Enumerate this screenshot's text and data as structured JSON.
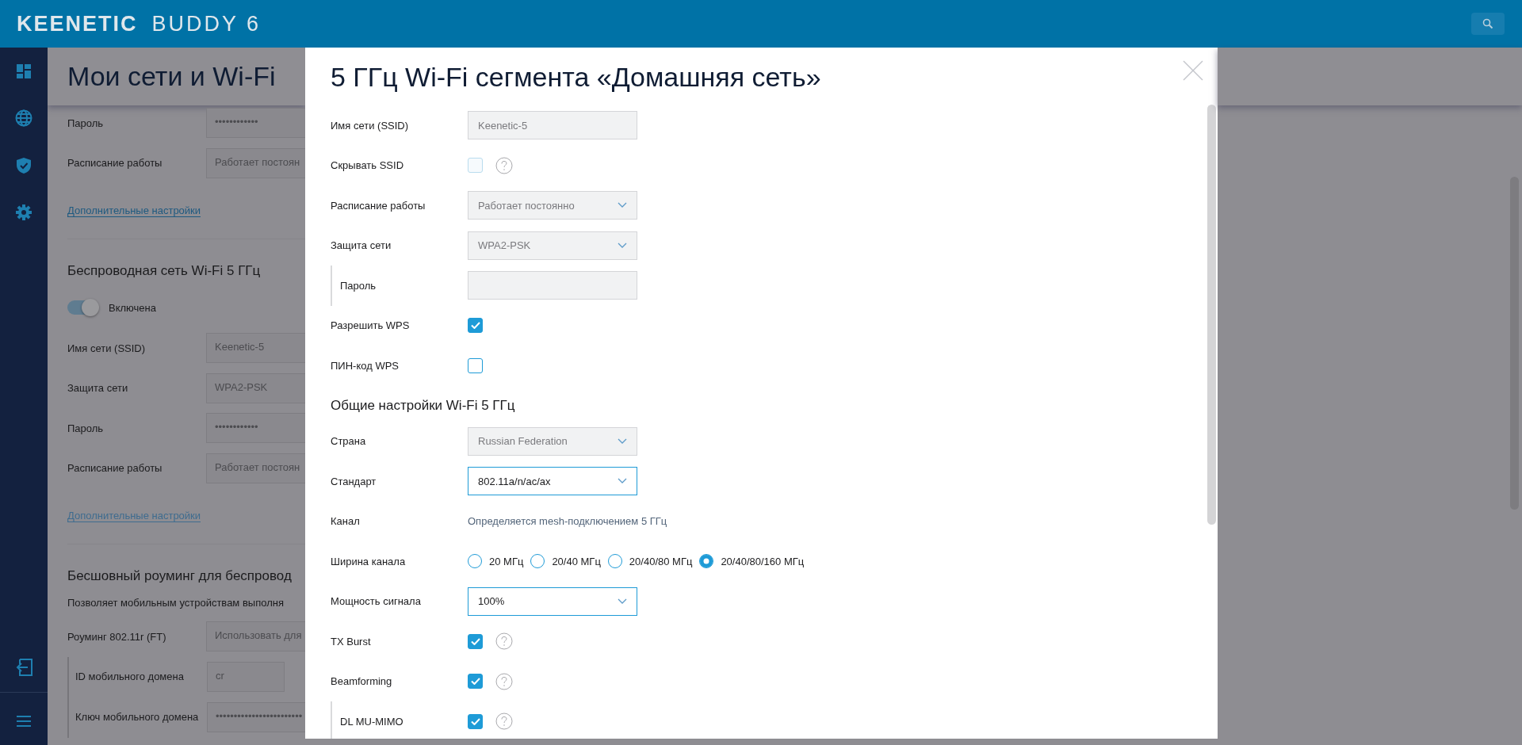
{
  "header": {
    "brand": "KEENETIC",
    "model": "BUDDY 6"
  },
  "background_page": {
    "title": "Мои сети и Wi-Fi",
    "items": [
      {
        "kind": "field",
        "label": "Пароль",
        "value": "••••••••••••"
      },
      {
        "kind": "field",
        "label": "Расписание работы",
        "value": "Работает постоян"
      },
      {
        "kind": "link",
        "label": "Дополнительные настройки",
        "disabled": false
      },
      {
        "kind": "heading",
        "label": "Беспроводная сеть Wi-Fi 5 ГГц"
      },
      {
        "kind": "toggle",
        "label": "Включена",
        "on": true
      },
      {
        "kind": "field",
        "label": "Имя сети (SSID)",
        "value": "Keenetic-5"
      },
      {
        "kind": "field",
        "label": "Защита сети",
        "value": "WPA2-PSK"
      },
      {
        "kind": "field",
        "label": "Пароль",
        "value": "••••••••••••"
      },
      {
        "kind": "field",
        "label": "Расписание работы",
        "value": "Работает постоян"
      },
      {
        "kind": "link",
        "label": "Дополнительные настройки",
        "disabled": true
      },
      {
        "kind": "heading",
        "label": "Бесшовный роуминг для беспровод"
      },
      {
        "kind": "text",
        "label": "Позволяет мобильным устройствам выполня"
      },
      {
        "kind": "field",
        "label": "Роуминг 802.11r (FT)",
        "value": "Использовать для"
      },
      {
        "kind": "subfield",
        "label": "ID мобильного домена",
        "value": "cr"
      },
      {
        "kind": "subfield",
        "label": "Ключ мобильного домена",
        "value": "••••••••••••••••••••••••"
      }
    ]
  },
  "modal": {
    "title": "5 ГГц Wi-Fi сегмента «Домашняя сеть»",
    "rows": [
      {
        "kind": "input",
        "label": "Имя сети (SSID)",
        "value": "Keenetic-5",
        "disabled": true
      },
      {
        "kind": "checkbox",
        "label": "Скрывать SSID",
        "checked": false,
        "disabled": true,
        "help": true
      },
      {
        "kind": "select",
        "label": "Расписание работы",
        "value": "Работает постоянно",
        "disabled": true
      },
      {
        "kind": "select",
        "label": "Защита сети",
        "value": "WPA2-PSK",
        "disabled": true
      },
      {
        "kind": "input",
        "label": "Пароль",
        "disabled": true,
        "sub": true
      },
      {
        "kind": "checkbox",
        "label": "Разрешить WPS",
        "checked": true,
        "disabled": false
      },
      {
        "kind": "checkbox",
        "label": "ПИН-код WPS",
        "checked": false,
        "disabled": false
      },
      {
        "kind": "heading",
        "label": "Общие настройки Wi-Fi 5 ГГц"
      },
      {
        "kind": "select",
        "label": "Страна",
        "value": "Russian Federation",
        "disabled": true
      },
      {
        "kind": "select",
        "label": "Стандарт",
        "value": "802.11a/n/ac/ax",
        "disabled": false
      },
      {
        "kind": "text",
        "label": "Канал",
        "value": "Определяется mesh-подключением 5 ГГц"
      },
      {
        "kind": "radio",
        "label": "Ширина канала",
        "options": [
          {
            "label": "20 МГц",
            "selected": false
          },
          {
            "label": "20/40 МГц",
            "selected": false
          },
          {
            "label": "20/40/80 МГц",
            "selected": false
          },
          {
            "label": "20/40/80/160 МГц",
            "selected": true
          }
        ]
      },
      {
        "kind": "select",
        "label": "Мощность сигнала",
        "value": "100%",
        "disabled": false
      },
      {
        "kind": "checkbox",
        "label": "TX Burst",
        "checked": true,
        "disabled": false,
        "help": true
      },
      {
        "kind": "checkbox",
        "label": "Beamforming",
        "checked": true,
        "disabled": false,
        "help": true
      },
      {
        "kind": "checkbox",
        "label": "DL MU-MIMO",
        "checked": true,
        "disabled": false,
        "help": true,
        "sub": true
      }
    ]
  }
}
